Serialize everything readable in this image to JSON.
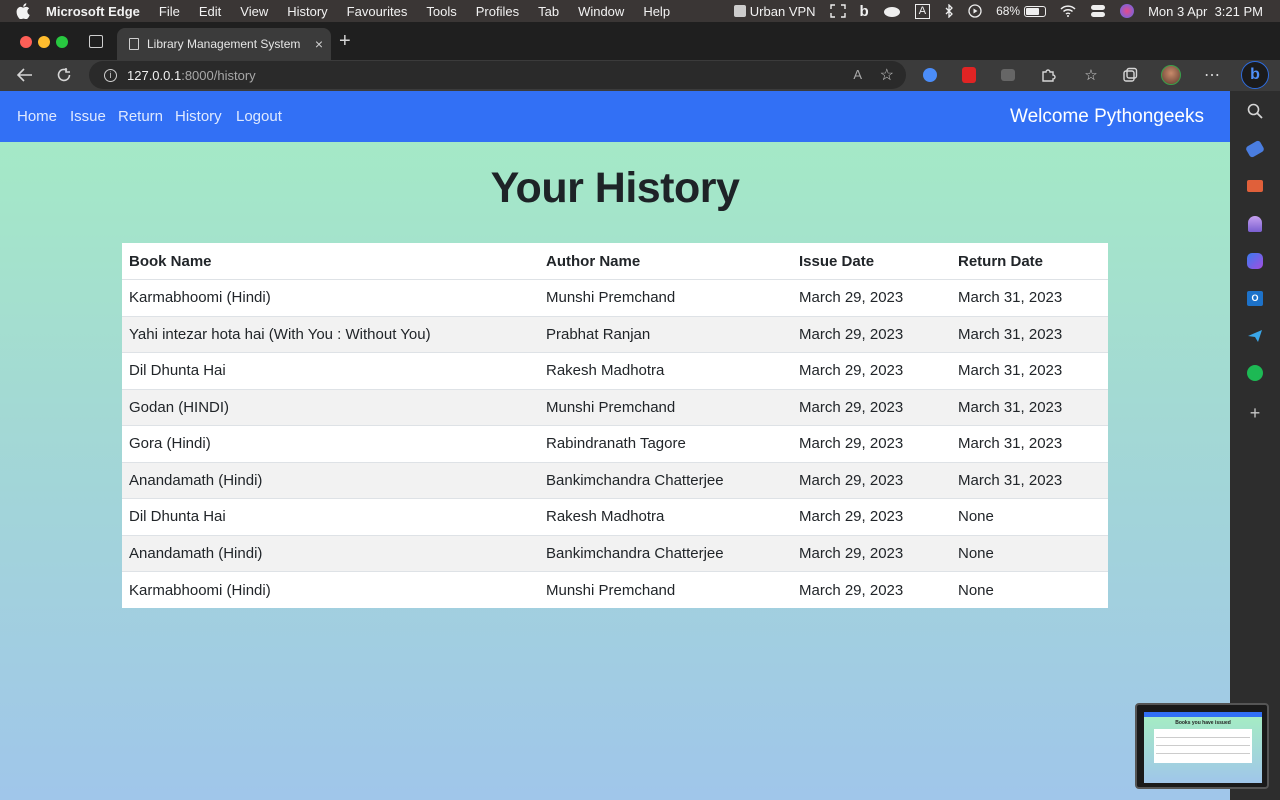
{
  "menubar": {
    "app_name": "Microsoft Edge",
    "items": [
      "File",
      "Edit",
      "View",
      "History",
      "Favourites",
      "Tools",
      "Profiles",
      "Tab",
      "Window",
      "Help"
    ],
    "vpn_label": "Urban VPN",
    "battery": "68%",
    "datetime": "Mon 3 Apr  3:21 PM"
  },
  "browser": {
    "tab_title": "Library Management System",
    "url_host": "127.0.0.1",
    "url_path": ":8000/history"
  },
  "navbar": {
    "links": [
      "Home",
      "Issue",
      "Return",
      "History",
      "Logout"
    ],
    "welcome": "Welcome Pythongeeks",
    "color": "#3270f5"
  },
  "page": {
    "title": "Your History"
  },
  "table": {
    "headers": [
      "Book Name",
      "Author Name",
      "Issue Date",
      "Return Date"
    ],
    "rows": [
      [
        "Karmabhoomi (Hindi)",
        "Munshi Premchand",
        "March 29, 2023",
        "March 31, 2023"
      ],
      [
        "Yahi intezar hota hai (With You : Without You)",
        "Prabhat Ranjan",
        "March 29, 2023",
        "March 31, 2023"
      ],
      [
        "Dil Dhunta Hai",
        "Rakesh Madhotra",
        "March 29, 2023",
        "March 31, 2023"
      ],
      [
        "Godan (HINDI)",
        "Munshi Premchand",
        "March 29, 2023",
        "March 31, 2023"
      ],
      [
        "Gora (Hindi)",
        "Rabindranath Tagore",
        "March 29, 2023",
        "March 31, 2023"
      ],
      [
        "Anandamath (Hindi)",
        "Bankimchandra Chatterjee",
        "March 29, 2023",
        "March 31, 2023"
      ],
      [
        "Dil Dhunta Hai",
        "Rakesh Madhotra",
        "March 29, 2023",
        "None"
      ],
      [
        "Anandamath (Hindi)",
        "Bankimchandra Chatterjee",
        "March 29, 2023",
        "None"
      ],
      [
        "Karmabhoomi (Hindi)",
        "Munshi Premchand",
        "March 29, 2023",
        "None"
      ]
    ]
  },
  "thumbnail": {
    "title": "Books you have issued"
  }
}
